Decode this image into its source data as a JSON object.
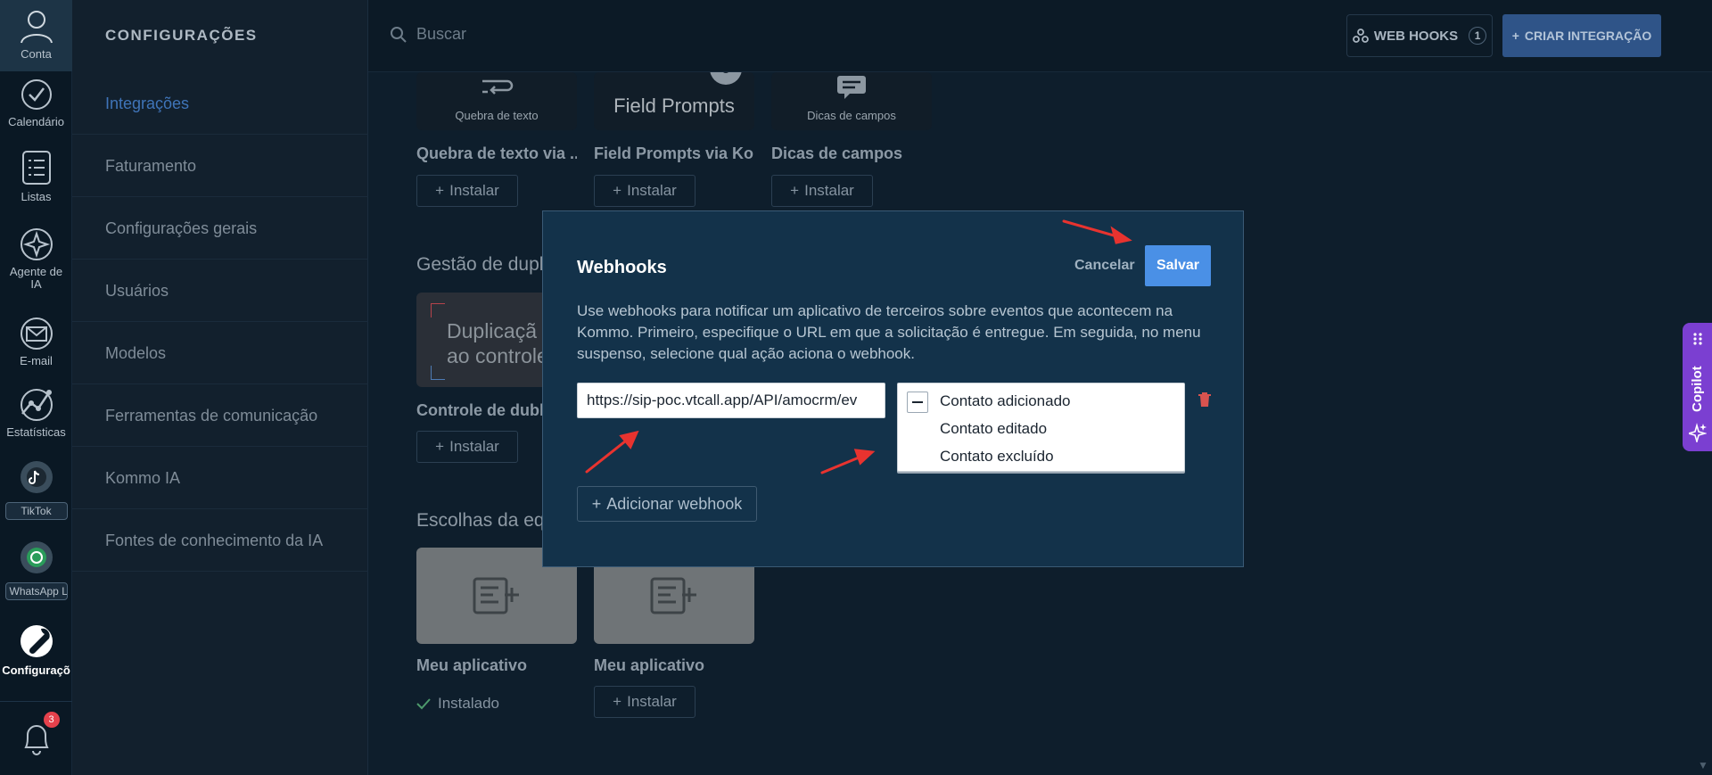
{
  "rail": {
    "account_label": "Conta",
    "calendar_label": "Calendário",
    "lists_label": "Listas",
    "ai_agent_label": "Agente de IA",
    "email_label": "E-mail",
    "stats_label": "Estatísticas",
    "tiktok_label": "TikTok",
    "whatsapp_label": "WhatsApp L",
    "settings_label": "Configuraçõ",
    "notifications_count": "3"
  },
  "sidebar": {
    "title": "CONFIGURAÇÕES",
    "items": [
      {
        "label": "Integrações",
        "active": true
      },
      {
        "label": "Faturamento"
      },
      {
        "label": "Configurações gerais"
      },
      {
        "label": "Usuários"
      },
      {
        "label": "Modelos"
      },
      {
        "label": "Ferramentas de comunicação"
      },
      {
        "label": "Kommo IA"
      },
      {
        "label": "Fontes de conhecimento da IA"
      }
    ]
  },
  "topbar": {
    "search_placeholder": "Buscar",
    "webhooks_label": "WEB HOOKS",
    "webhooks_count": "1",
    "create_label": "CRIAR INTEGRAÇÃO"
  },
  "main": {
    "cards": [
      {
        "image_text": "Quebra de texto",
        "name": "Quebra de texto via ...",
        "action": "Instalar"
      },
      {
        "image_text": "Field Prompts",
        "name": "Field Prompts via Ko...",
        "action": "Instalar"
      },
      {
        "image_text": "Dicas de campos",
        "name": "Dicas de campos",
        "action": "Instalar"
      }
    ],
    "section_dup_title": "Gestão de dupl",
    "dup_card_line1": "Duplicaçã",
    "dup_card_line2": "ao controle",
    "dup_card_name": "Controle de dubla",
    "dup_card_action": "Instalar",
    "section_team_title": "Escolhas da equ",
    "apps": [
      {
        "name": "Meu aplicativo",
        "status": "Instalado"
      },
      {
        "name": "Meu aplicativo",
        "action": "Instalar"
      }
    ]
  },
  "modal": {
    "title": "Webhooks",
    "cancel_label": "Cancelar",
    "save_label": "Salvar",
    "description": "Use webhooks para notificar um aplicativo de terceiros sobre eventos que acontecem na Kommo. Primeiro, especifique o URL em que a solicitação é entregue. Em seguida, no menu suspenso, selecione qual ação aciona o webhook.",
    "url_value": "https://sip-poc.vtcall.app/API/amocrm/ev",
    "events": [
      "Contato adicionado",
      "Contato editado",
      "Contato excluído"
    ],
    "add_label": "Adicionar webhook"
  },
  "copilot": {
    "label": "Copilot"
  },
  "colors": {
    "accent": "#4a90e6",
    "copilot": "#7b3fd1",
    "badge": "#e5414c",
    "annotation": "#e8332f"
  }
}
